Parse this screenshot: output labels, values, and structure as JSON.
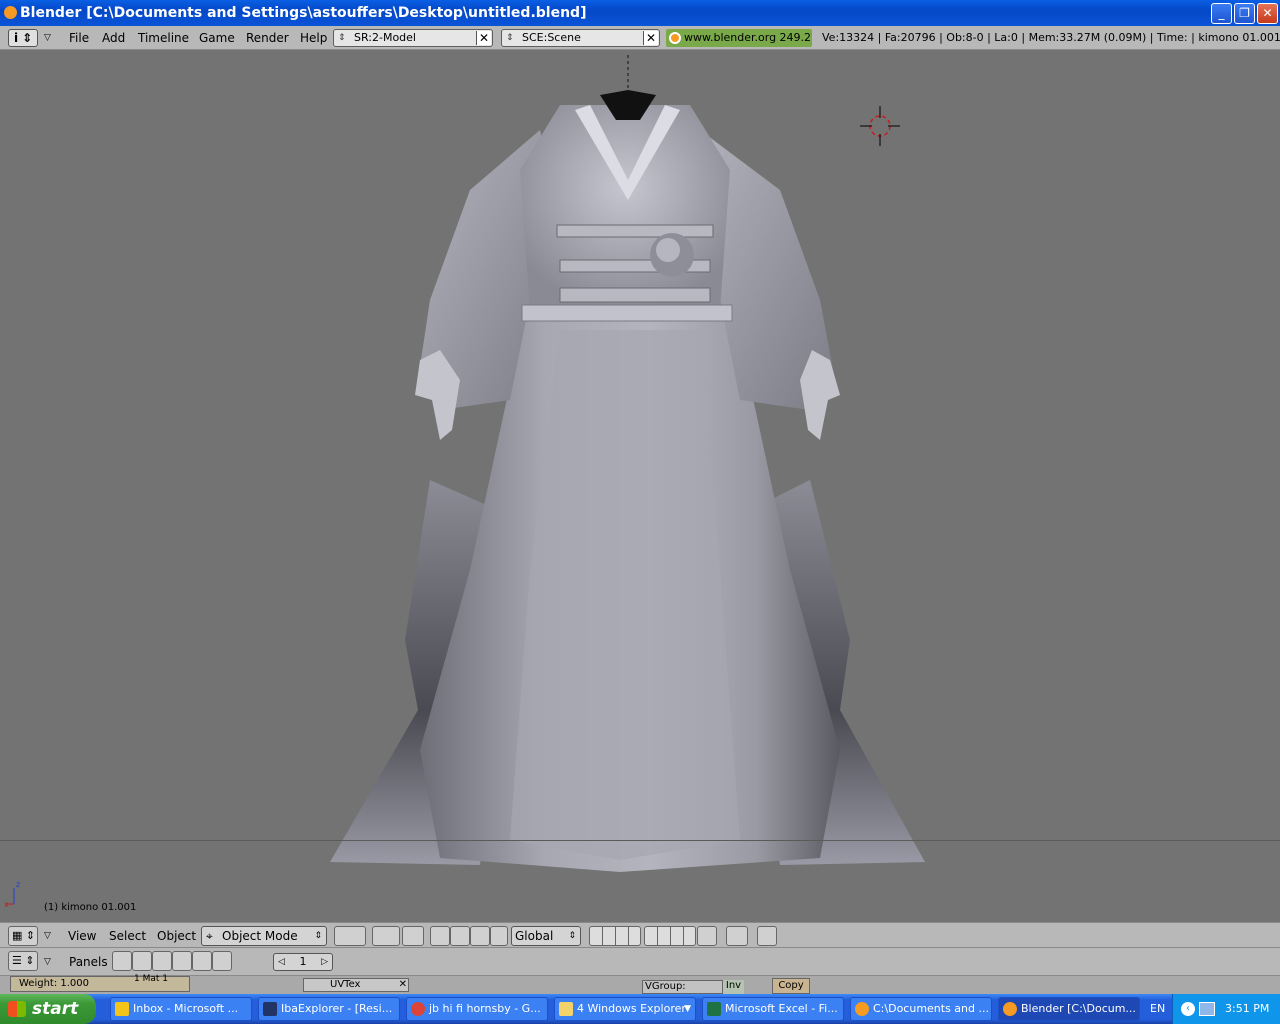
{
  "window": {
    "title": "Blender [C:\\Documents and Settings\\astouffers\\Desktop\\untitled.blend]"
  },
  "menubar": {
    "type_icon": "i",
    "menus": [
      "File",
      "Add",
      "Timeline",
      "Game",
      "Render",
      "Help"
    ],
    "screen_field": "SR:2-Model",
    "scene_field": "SCE:Scene",
    "link": "www.blender.org 249.2",
    "stats": "Ve:13324 | Fa:20796 | Ob:8-0 | La:0  | Mem:33.27M (0.09M)  | Time: | kimono 01.001"
  },
  "viewport": {
    "object_label": "(1) kimono 01.001",
    "axis_x": "x",
    "axis_z": "z"
  },
  "toolbar": {
    "menus": [
      "View",
      "Select",
      "Object"
    ],
    "mode": "Object Mode",
    "orientation": "Global"
  },
  "buttons": {
    "panels_label": "Panels",
    "frame": "1",
    "weight": "Weight: 1.000",
    "mat": "1 Mat 1",
    "uvtex": "UVTex",
    "vgroup": "VGroup:",
    "inv": "Inv",
    "copy": "Copy"
  },
  "taskbar": {
    "start": "start",
    "tasks": [
      "Inbox - Microsoft ...",
      "IbaExplorer - [Resi...",
      "jb hi fi hornsby - G...",
      "4 Windows Explorer",
      "Microsoft Excel - Fi...",
      "C:\\Documents and ...",
      "Blender [C:\\Docum..."
    ],
    "lang": "EN",
    "clock": "3:51 PM"
  }
}
